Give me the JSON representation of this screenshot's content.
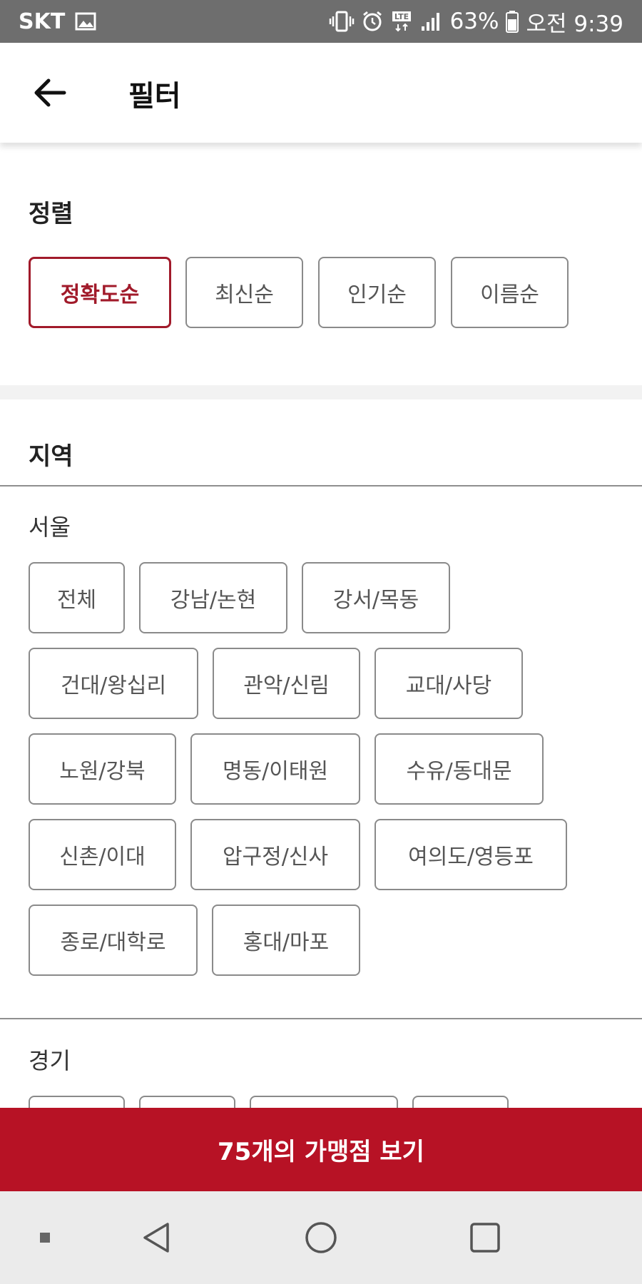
{
  "status_bar": {
    "carrier": "SKT",
    "battery": "63%",
    "time": "오전 9:39",
    "network": "LTE"
  },
  "header": {
    "title": "필터"
  },
  "sort": {
    "title": "정렬",
    "options": [
      "정확도순",
      "최신순",
      "인기순",
      "이름순"
    ],
    "selected": "정확도순"
  },
  "region": {
    "title": "지역",
    "seoul": {
      "label": "서울",
      "options": [
        "전체",
        "강남/논현",
        "강서/목동",
        "건대/왕십리",
        "관악/신림",
        "교대/사당",
        "노원/강북",
        "명동/이태원",
        "수유/동대문",
        "신촌/이대",
        "압구정/신사",
        "여의도/영등포",
        "종로/대학로",
        "홍대/마포"
      ]
    },
    "gyeonggi": {
      "label": "경기"
    }
  },
  "cta": {
    "label": "75개의 가맹점 보기"
  },
  "colors": {
    "accent": "#b71225",
    "selected": "#a11a2a",
    "status_bar": "#6e6e6e"
  }
}
